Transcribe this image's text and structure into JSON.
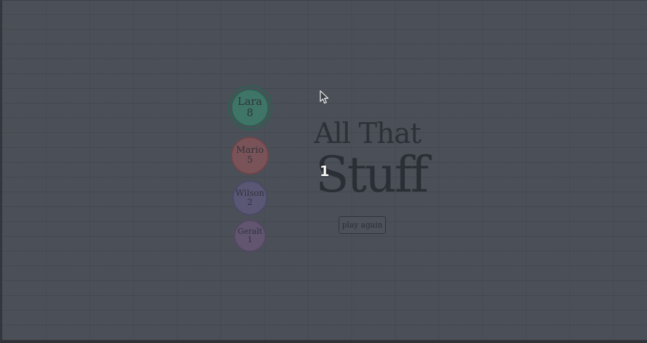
{
  "game": {
    "title_line1": "All That",
    "title_line2": "Stuff",
    "counter": "1",
    "play_again_label": "play again"
  },
  "players": [
    {
      "name": "Lara",
      "score": "8",
      "color": "#3f7566"
    },
    {
      "name": "Mario",
      "score": "5",
      "color": "#7a5359"
    },
    {
      "name": "Wilson",
      "score": "2",
      "color": "#5a5775"
    },
    {
      "name": "Geralt",
      "score": "1",
      "color": "#615570"
    }
  ],
  "icons": {
    "cursor": "mouse-pointer-icon"
  },
  "colors": {
    "background": "#4b5058",
    "text": "#2a2e35"
  }
}
